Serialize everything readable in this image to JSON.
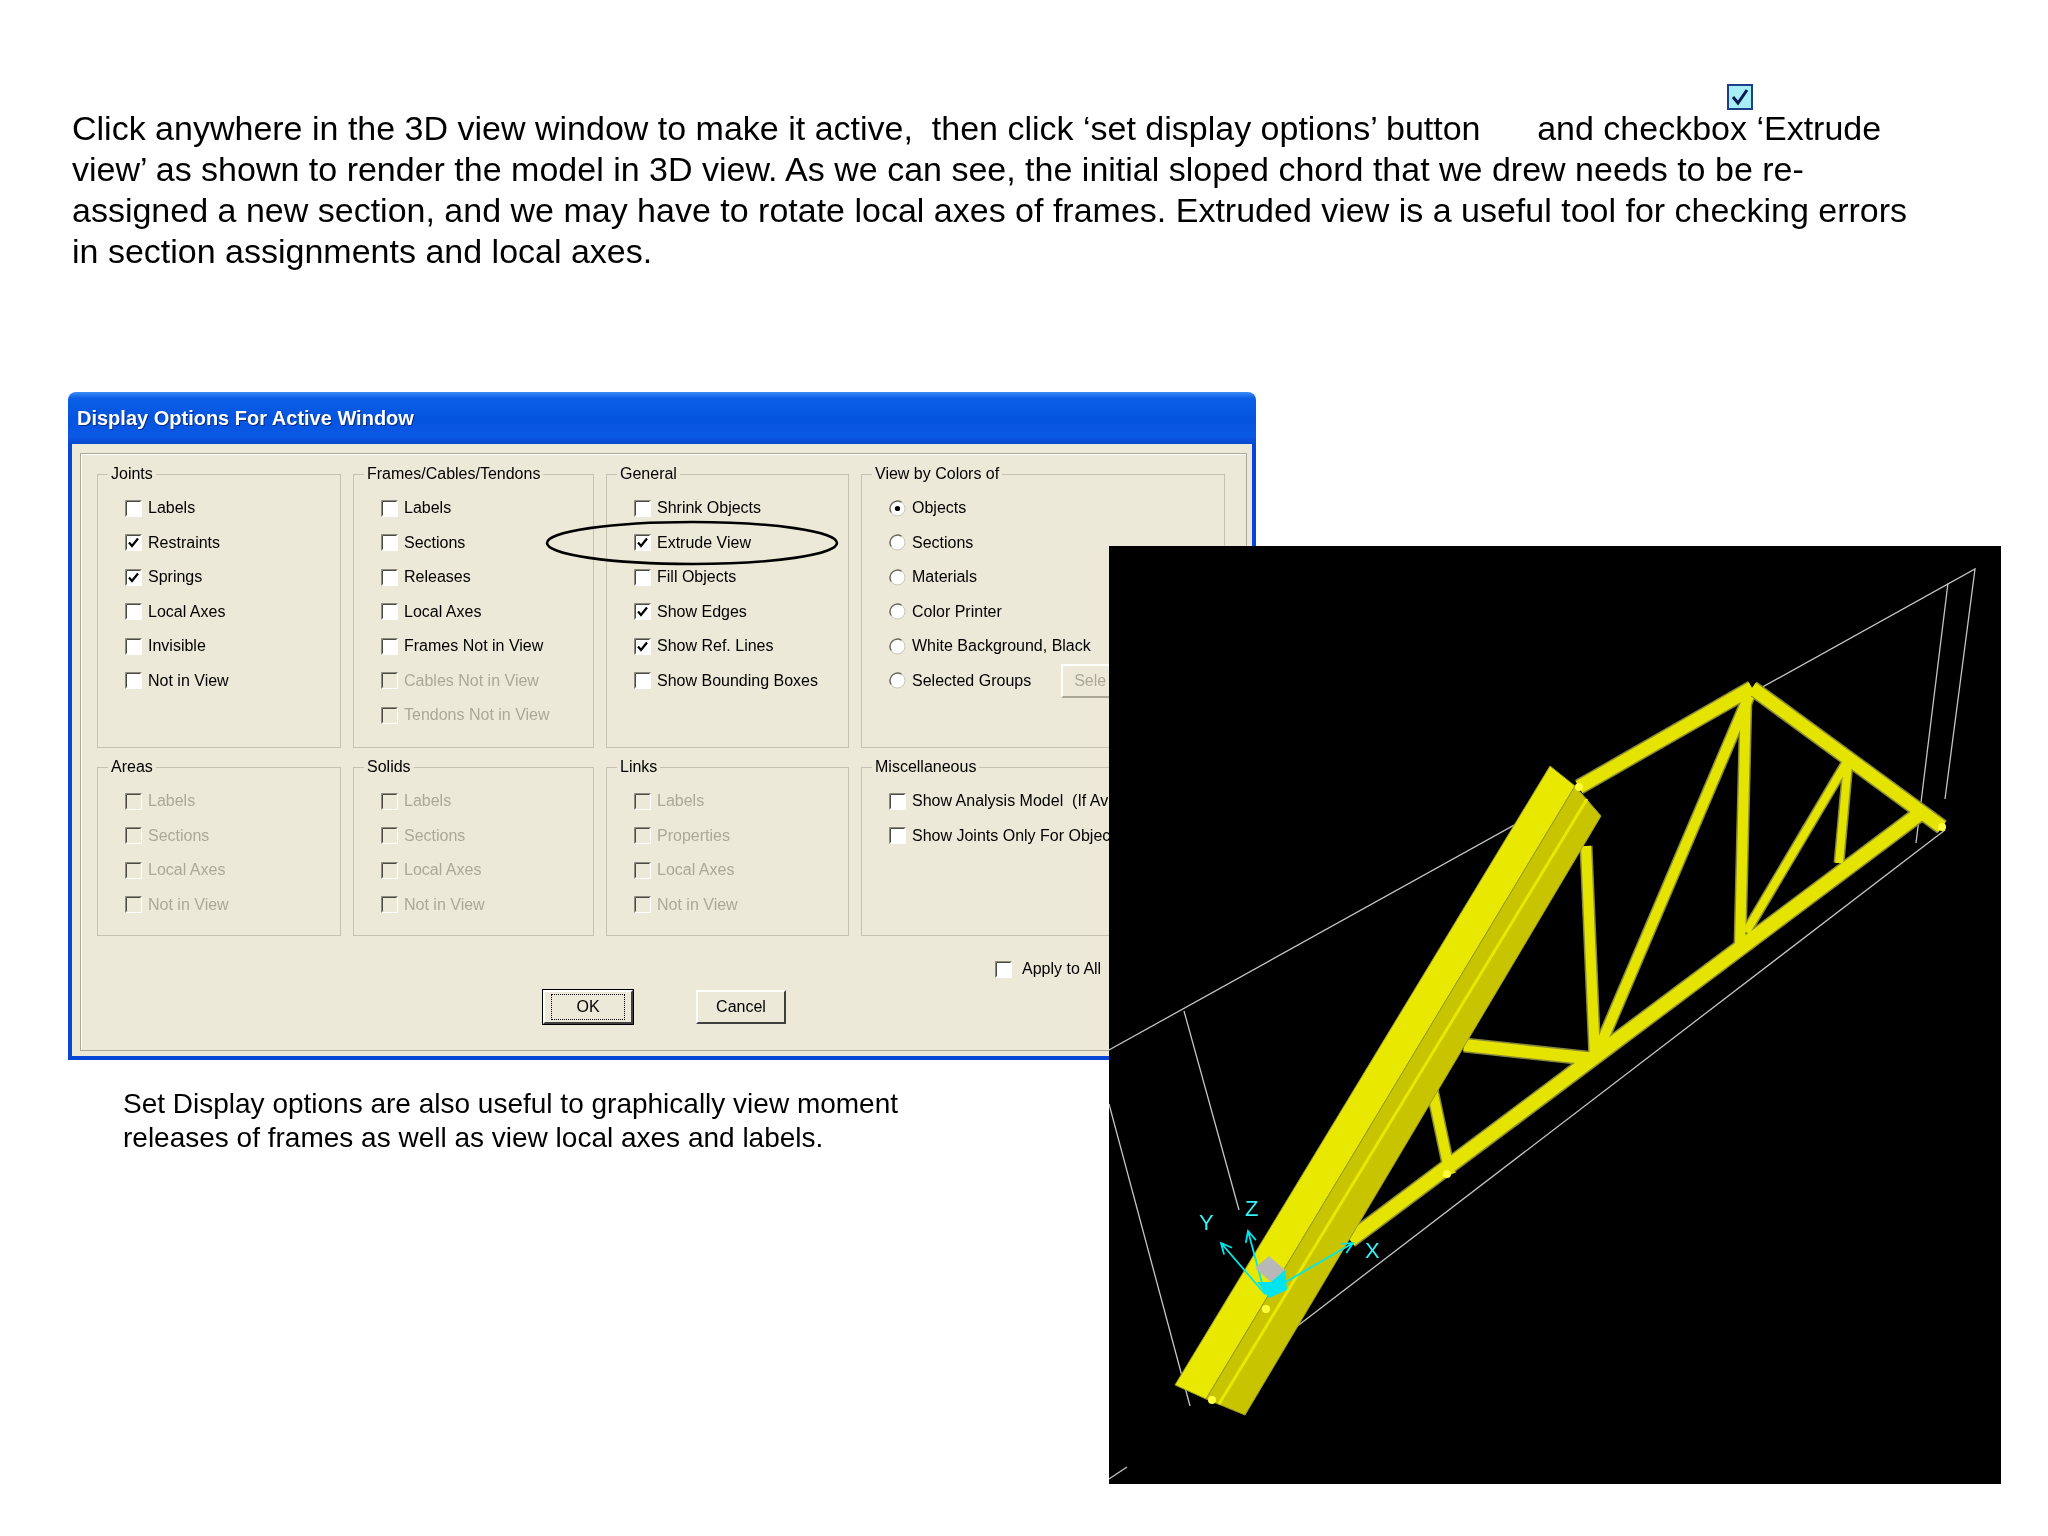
{
  "instructions": "Click anywhere in the 3D view window to make it active,  then click ‘set display options’ button      and checkbox ‘Extrude view’ as shown to render the model in 3D view. As we can see, the initial sloped chord that we drew needs to be re-assigned a new section, and we may have to rotate local axes of frames. Extruded view is a useful tool for checking errors in section assignments and local axes.",
  "dialog": {
    "title": "Display Options For Active Window",
    "groups": [
      {
        "title": "Joints",
        "kind": "checkboxes",
        "items": [
          {
            "label": "Labels",
            "checked": false,
            "disabled": false
          },
          {
            "label": "Restraints",
            "checked": true,
            "disabled": false
          },
          {
            "label": "Springs",
            "checked": true,
            "disabled": false
          },
          {
            "label": "Local Axes",
            "checked": false,
            "disabled": false
          },
          {
            "label": "Invisible",
            "checked": false,
            "disabled": false
          },
          {
            "label": "Not in View",
            "checked": false,
            "disabled": false
          }
        ]
      },
      {
        "title": "Frames/Cables/Tendons",
        "kind": "checkboxes",
        "items": [
          {
            "label": "Labels",
            "checked": false,
            "disabled": false
          },
          {
            "label": "Sections",
            "checked": false,
            "disabled": false
          },
          {
            "label": "Releases",
            "checked": false,
            "disabled": false
          },
          {
            "label": "Local Axes",
            "checked": false,
            "disabled": false
          },
          {
            "label": "Frames Not in View",
            "checked": false,
            "disabled": false
          },
          {
            "label": "Cables Not in View",
            "checked": false,
            "disabled": true
          },
          {
            "label": "Tendons Not in View",
            "checked": false,
            "disabled": true
          }
        ]
      },
      {
        "title": "General",
        "kind": "checkboxes",
        "items": [
          {
            "label": "Shrink Objects",
            "checked": false,
            "disabled": false
          },
          {
            "label": "Extrude View",
            "checked": true,
            "disabled": false
          },
          {
            "label": "Fill Objects",
            "checked": false,
            "disabled": false
          },
          {
            "label": "Show Edges",
            "checked": true,
            "disabled": false
          },
          {
            "label": "Show Ref. Lines",
            "checked": true,
            "disabled": false
          },
          {
            "label": "Show Bounding Boxes",
            "checked": false,
            "disabled": false
          }
        ]
      },
      {
        "title": "View by Colors of",
        "kind": "radios",
        "items": [
          {
            "label": "Objects",
            "selected": true
          },
          {
            "label": "Sections",
            "selected": false
          },
          {
            "label": "Materials",
            "selected": false
          },
          {
            "label": "Color Printer",
            "selected": false
          },
          {
            "label": "White Background, Black",
            "selected": false
          },
          {
            "label": "Selected Groups",
            "selected": false,
            "button": {
              "label": "Sele",
              "disabled": true
            }
          }
        ]
      },
      {
        "title": "Areas",
        "kind": "checkboxes",
        "items": [
          {
            "label": "Labels",
            "checked": false,
            "disabled": true
          },
          {
            "label": "Sections",
            "checked": false,
            "disabled": true
          },
          {
            "label": "Local Axes",
            "checked": false,
            "disabled": true
          },
          {
            "label": "Not in View",
            "checked": false,
            "disabled": true
          }
        ]
      },
      {
        "title": "Solids",
        "kind": "checkboxes",
        "items": [
          {
            "label": "Labels",
            "checked": false,
            "disabled": true
          },
          {
            "label": "Sections",
            "checked": false,
            "disabled": true
          },
          {
            "label": "Local Axes",
            "checked": false,
            "disabled": true
          },
          {
            "label": "Not in View",
            "checked": false,
            "disabled": true
          }
        ]
      },
      {
        "title": "Links",
        "kind": "checkboxes",
        "items": [
          {
            "label": "Labels",
            "checked": false,
            "disabled": true
          },
          {
            "label": "Properties",
            "checked": false,
            "disabled": true
          },
          {
            "label": "Local Axes",
            "checked": false,
            "disabled": true
          },
          {
            "label": "Not in View",
            "checked": false,
            "disabled": true
          }
        ]
      },
      {
        "title": "Miscellaneous",
        "kind": "checkboxes",
        "items": [
          {
            "label": "Show Analysis Model  (If Av",
            "checked": false,
            "disabled": false
          },
          {
            "label": "Show Joints Only For Objec",
            "checked": false,
            "disabled": false
          }
        ]
      }
    ],
    "apply_to_all": {
      "label": "Apply to All",
      "checked": false
    },
    "buttons": [
      {
        "label": "OK",
        "default": true
      },
      {
        "label": "Cancel",
        "default": false
      }
    ]
  },
  "viewport": {
    "axis_labels": [
      "Y",
      "Z",
      "X"
    ]
  },
  "caption": "Set Display options are also useful to graphically view moment releases of frames as well as view local axes and labels."
}
